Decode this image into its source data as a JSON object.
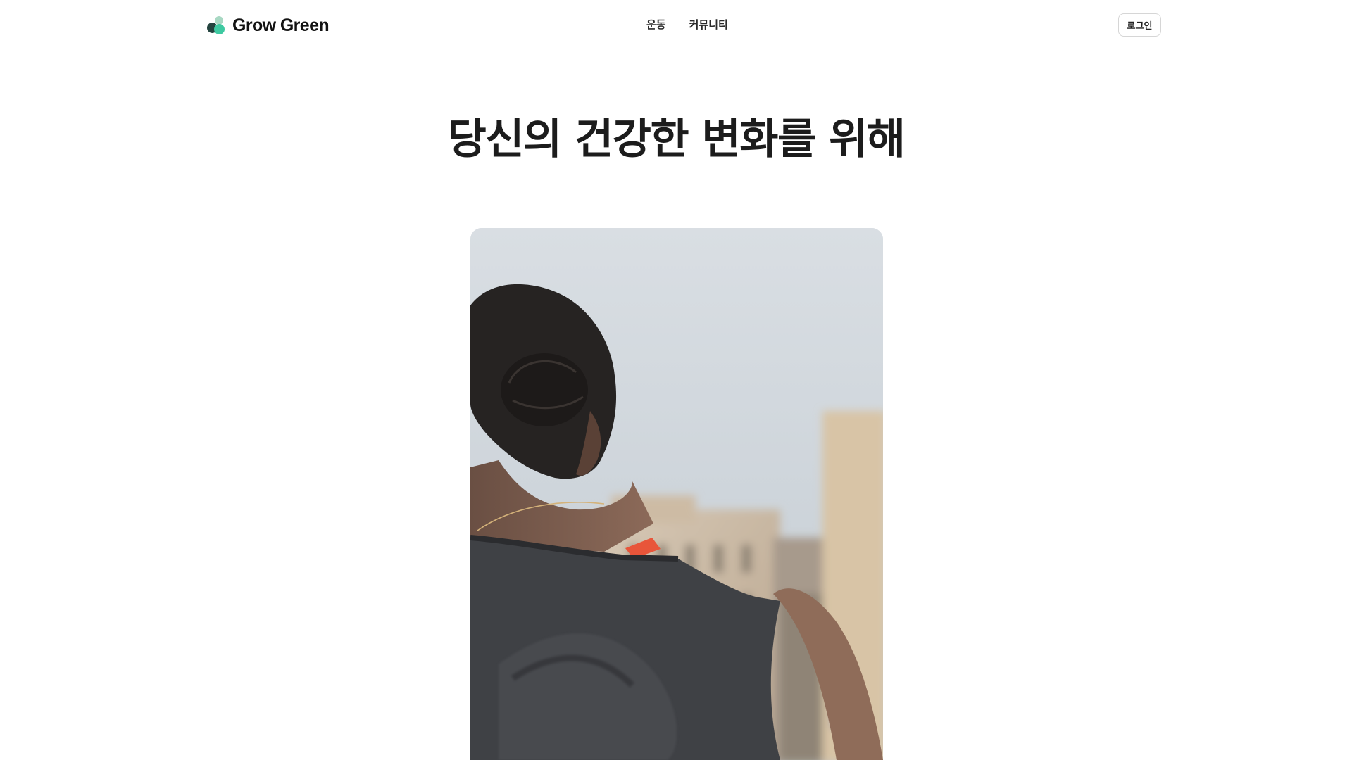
{
  "header": {
    "logo_text": "Grow Green",
    "nav": [
      {
        "label": "운동"
      },
      {
        "label": "커뮤니티"
      }
    ],
    "login_label": "로그인"
  },
  "hero": {
    "title": "당신의 건강한 변화를 위해",
    "image_subject": "person-with-hair-bun-back-view"
  },
  "colors": {
    "brand_dark": "#24443f",
    "brand_mint": "#3ec9a1",
    "brand_light": "#a8d8c3",
    "text": "#1c1c1c"
  }
}
